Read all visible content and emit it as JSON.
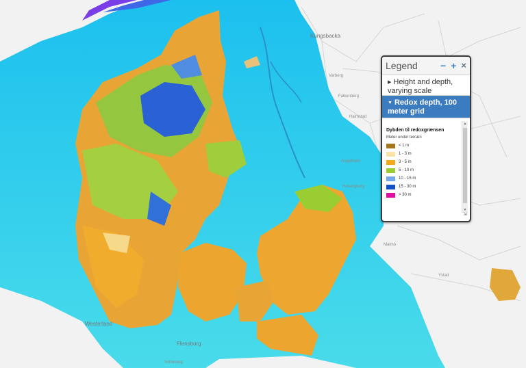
{
  "map": {
    "place_labels": [
      "Kungsbacka",
      "Varberg",
      "Falkenberg",
      "Halmstad",
      "Ängelholm",
      "Helsingborg",
      "Malmö",
      "Ystad",
      "Westerland",
      "Flensburg",
      "Schleswig"
    ]
  },
  "legend": {
    "title": "Legend",
    "minimize_symbol": "−",
    "expand_symbol": "+",
    "close_symbol": "×",
    "layers": [
      {
        "label": "Height and depth, varying scale",
        "state": "collapsed"
      },
      {
        "label": "Redox depth, 100 meter grid",
        "state": "expanded"
      }
    ],
    "subtitle": "Dybden til redoxgrænsen",
    "unit": "Meter under terræn",
    "entries": [
      {
        "label": "< 1 m",
        "color": "#a6761d"
      },
      {
        "label": "1 - 3 m",
        "color": "#fbe3a6"
      },
      {
        "label": "3 - 5 m",
        "color": "#f2a91e"
      },
      {
        "label": "5 - 10 m",
        "color": "#9acd32"
      },
      {
        "label": "10 - 15 m",
        "color": "#74a9e6"
      },
      {
        "label": "15 - 30 m",
        "color": "#1450c8"
      },
      {
        "label": "> 30 m",
        "color": "#e010a0"
      }
    ],
    "resize_icon": "⇲"
  },
  "colors": {
    "sea": "#33d3ee",
    "deep_sea": "#7a3ee6",
    "land": "#f2f2f2"
  }
}
